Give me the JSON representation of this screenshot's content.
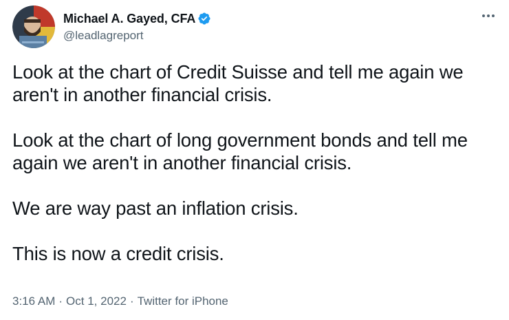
{
  "author": {
    "display_name": "Michael A. Gayed, CFA",
    "handle": "@leadlagreport",
    "verified": true
  },
  "icons": {
    "avatar": "profile-avatar",
    "verified": "verified-badge-icon",
    "more": "more-options-icon"
  },
  "colors": {
    "text_primary": "#0f1419",
    "text_secondary": "#536471",
    "verified_blue": "#1d9bf0"
  },
  "tweet": {
    "paragraphs": [
      "Look at the chart of Credit Suisse and tell me again we aren't in another financial crisis.",
      "Look at the chart of long government bonds and tell me again we aren't in another financial crisis.",
      "We are way past an inflation crisis.",
      "This is now a credit crisis."
    ]
  },
  "meta": {
    "time": "3:16 AM",
    "separator": "·",
    "date": "Oct 1, 2022",
    "source": "Twitter for iPhone"
  }
}
